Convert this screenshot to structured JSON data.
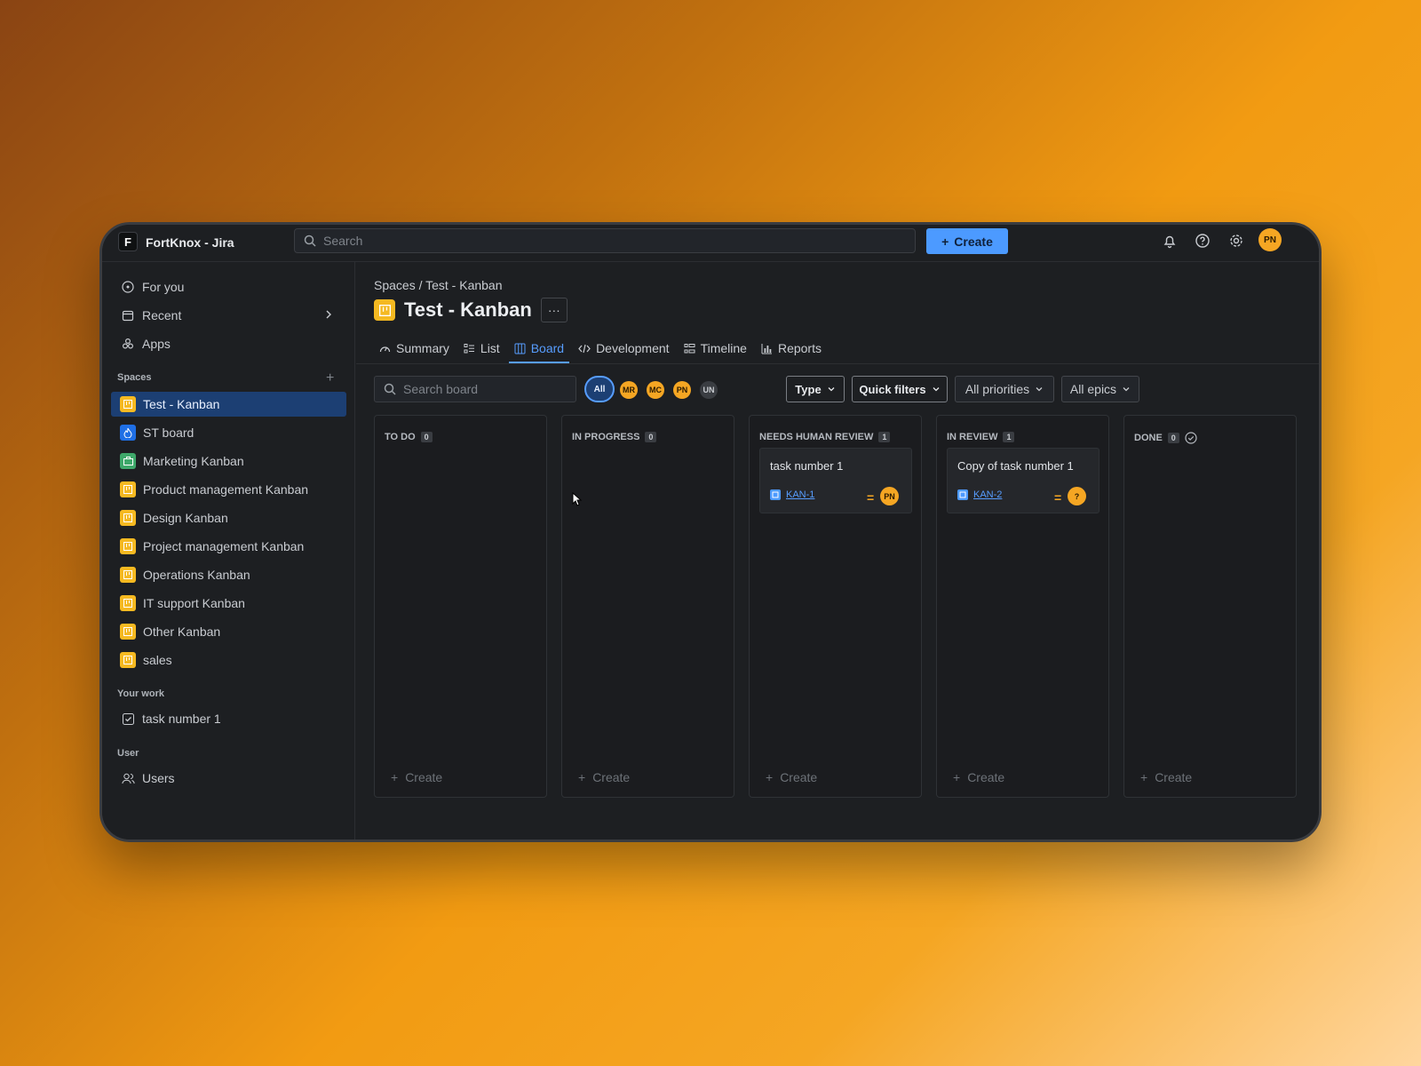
{
  "app": {
    "logo_letter": "F",
    "title": "FortKnox - Jira"
  },
  "topbar": {
    "search_placeholder": "Search",
    "create_label": "Create",
    "icons": [
      "bell-icon",
      "help-icon",
      "gear-icon"
    ],
    "user_initials": "PN"
  },
  "sidebar": {
    "nav": [
      {
        "label": "For you",
        "icon": "target-icon"
      },
      {
        "label": "Recent",
        "icon": "calendar-icon"
      },
      {
        "label": "Apps",
        "icon": "apps-icon"
      }
    ],
    "spaces_label": "Spaces",
    "spaces": [
      {
        "label": "Test - Kanban",
        "color": "#f5b921",
        "active": true
      },
      {
        "label": "ST board",
        "color": "#1f6fe5"
      },
      {
        "label": "Marketing Kanban",
        "color": "#3ea86a"
      },
      {
        "label": "Product management Kanban",
        "color": "#f5b921"
      },
      {
        "label": "Design Kanban",
        "color": "#f5b921"
      },
      {
        "label": "Project management Kanban",
        "color": "#f5b921"
      },
      {
        "label": "Operations Kanban",
        "color": "#f5b921"
      },
      {
        "label": "IT support Kanban",
        "color": "#f5b921"
      },
      {
        "label": "Other Kanban",
        "color": "#f5b921"
      },
      {
        "label": "sales",
        "color": "#f5b921"
      }
    ],
    "your_work_label": "Your work",
    "your_work": [
      {
        "label": "task number 1"
      }
    ],
    "user_label": "User",
    "user_items": [
      {
        "label": "Users"
      }
    ]
  },
  "main": {
    "breadcrumb": "Spaces / Test - Kanban",
    "title": "Test - Kanban",
    "more_label": "···",
    "tabs": [
      {
        "label": "Summary"
      },
      {
        "label": "List"
      },
      {
        "label": "Board",
        "active": true
      },
      {
        "label": "Development"
      },
      {
        "label": "Timeline"
      },
      {
        "label": "Reports"
      }
    ],
    "board_search_placeholder": "Search board",
    "filter_avatars": [
      "All",
      "MR",
      "MC",
      "PN",
      "UN"
    ],
    "filters": [
      "Type",
      "Quick filters",
      "All priorities",
      "All epics"
    ],
    "columns": [
      {
        "name": "TO DO",
        "count": "0",
        "create": "Create",
        "cards": []
      },
      {
        "name": "IN PROGRESS",
        "count": "0",
        "create": "Create",
        "cards": []
      },
      {
        "name": "NEEDS HUMAN REVIEW",
        "count": "1",
        "create": "Create",
        "cards": [
          {
            "title": "task number 1",
            "key": "KAN-1",
            "assignee": "PN"
          }
        ]
      },
      {
        "name": "IN REVIEW",
        "count": "1",
        "create": "Create",
        "cards": [
          {
            "title": "Copy of task number 1",
            "key": "KAN-2",
            "assignee": "?"
          }
        ]
      },
      {
        "name": "DONE",
        "count": "0",
        "create": "Create",
        "cards": []
      }
    ]
  },
  "colors": {
    "accent": "#579dff",
    "brand_orange": "#f5a623",
    "active_bg": "#1c3f73"
  }
}
